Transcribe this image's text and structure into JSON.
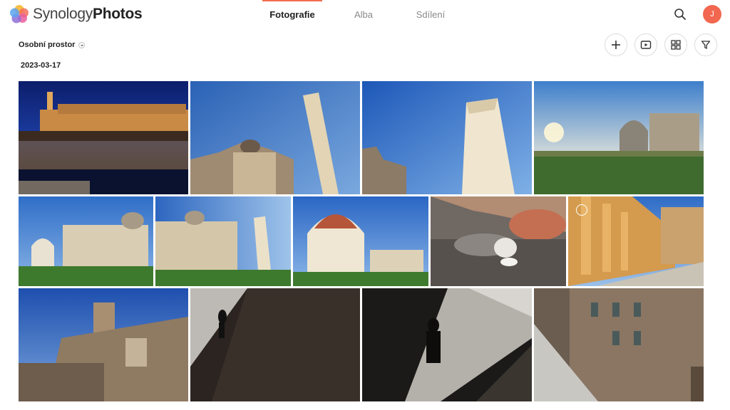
{
  "app": {
    "brand_light": "Synology",
    "brand_bold": "Photos"
  },
  "nav": {
    "tabs": [
      {
        "label": "Fotografie",
        "active": true
      },
      {
        "label": "Alba",
        "active": false
      },
      {
        "label": "Sdílení",
        "active": false
      }
    ]
  },
  "user": {
    "initial": "J"
  },
  "toolbar": {
    "space_label": "Osobní prostor"
  },
  "timeline": {
    "date": "2023-03-17"
  },
  "icons": {
    "search": "search-icon",
    "add": "plus-icon",
    "slideshow": "play-icon",
    "view": "grid-icon",
    "filter": "filter-icon"
  },
  "colors": {
    "accent": "#f26c4f",
    "avatar": "#f2674f"
  }
}
